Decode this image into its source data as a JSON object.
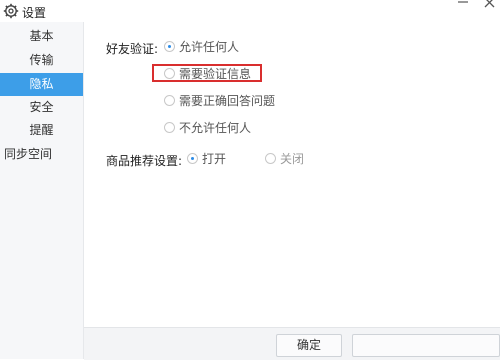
{
  "window": {
    "title": "设置"
  },
  "sidebar": {
    "items": [
      {
        "label": "基本"
      },
      {
        "label": "传输"
      },
      {
        "label": "隐私"
      },
      {
        "label": "安全"
      },
      {
        "label": "提醒"
      },
      {
        "label": "同步空间"
      }
    ],
    "active_index": 2
  },
  "privacy": {
    "friend_verify": {
      "label": "好友验证:",
      "options": [
        {
          "label": "允许任何人",
          "selected": true
        },
        {
          "label": "需要验证信息",
          "selected": false
        },
        {
          "label": "需要正确回答问题",
          "selected": false
        },
        {
          "label": "不允许任何人",
          "selected": false
        }
      ]
    },
    "recommend": {
      "label": "商品推荐设置:",
      "options": [
        {
          "label": "打开",
          "selected": true
        },
        {
          "label": "关闭",
          "selected": false,
          "disabled": true
        }
      ]
    }
  },
  "footer": {
    "ok_label": "确定",
    "cancel_label": ""
  },
  "colors": {
    "accent": "#3d9ee8",
    "highlight_border": "#d92e2e"
  }
}
